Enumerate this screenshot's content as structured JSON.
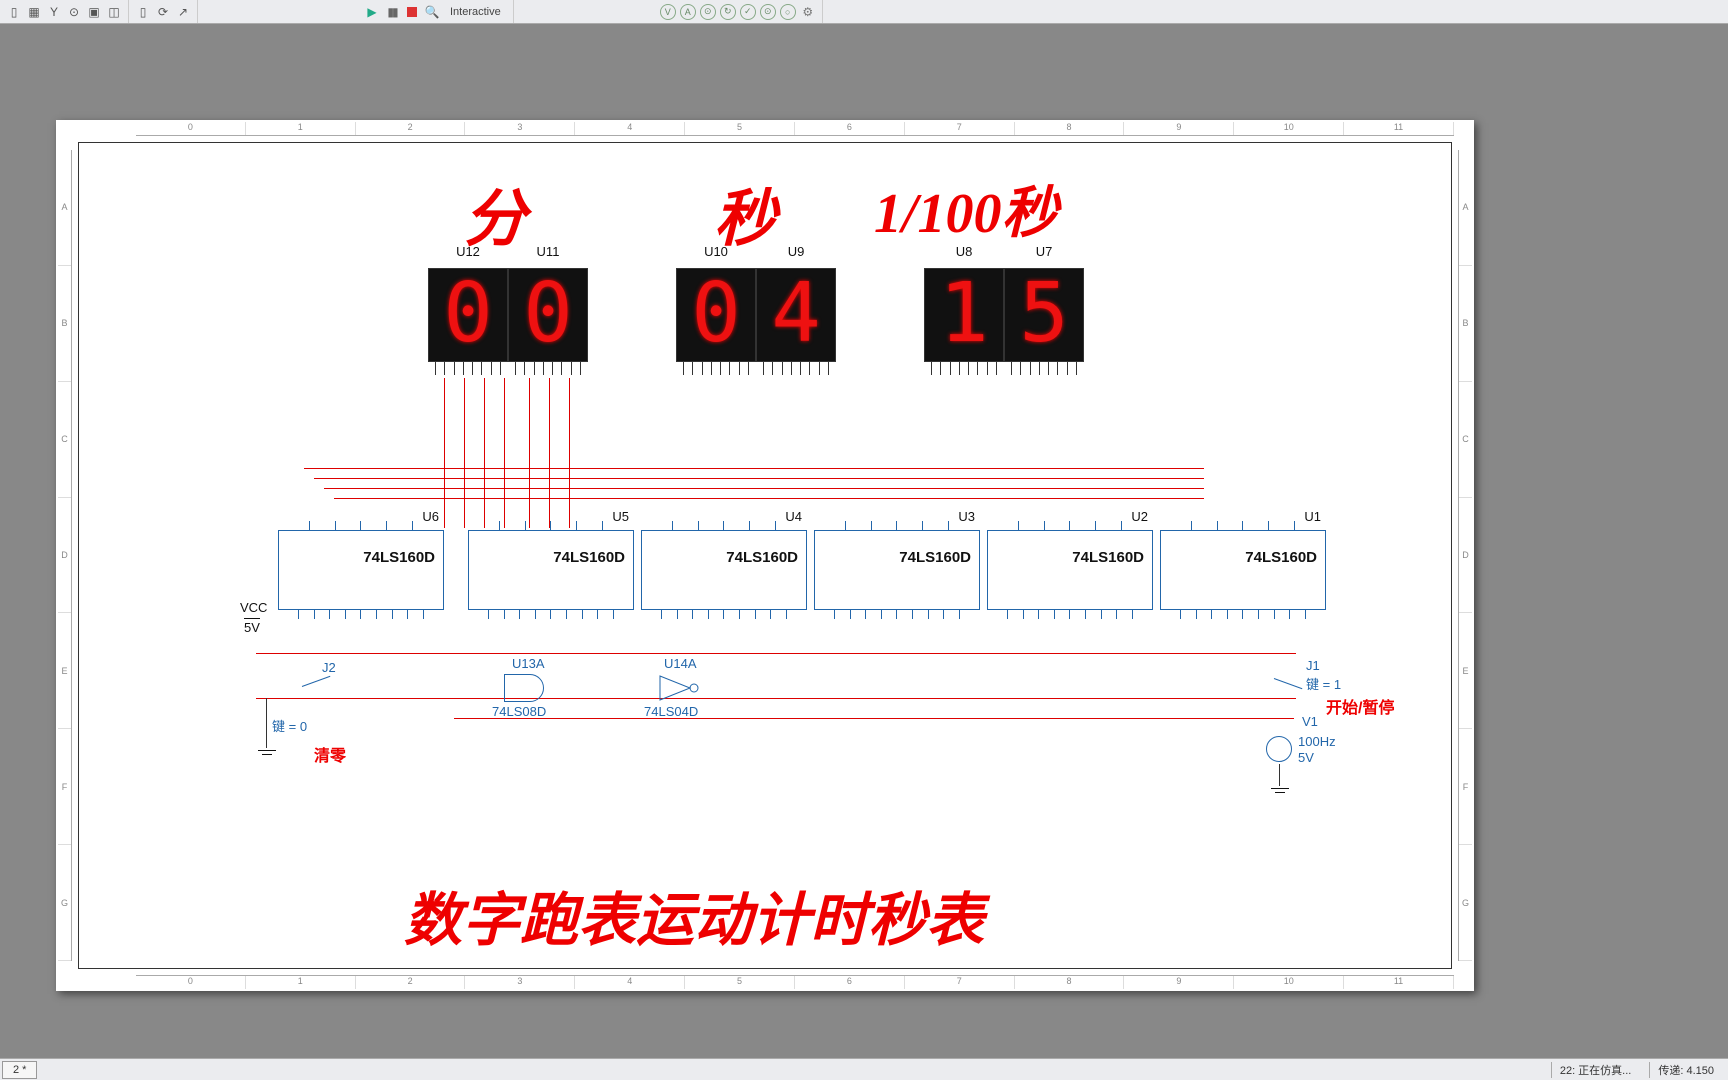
{
  "toolbar": {
    "interactive": "Interactive"
  },
  "headers": {
    "min": "分",
    "sec": "秒",
    "cs": "1/100秒"
  },
  "displays": {
    "u12": {
      "ref": "U12",
      "digit": "0"
    },
    "u11": {
      "ref": "U11",
      "digit": "0"
    },
    "u10": {
      "ref": "U10",
      "digit": "0"
    },
    "u9": {
      "ref": "U9",
      "digit": "4"
    },
    "u8": {
      "ref": "U8",
      "digit": "1"
    },
    "u7": {
      "ref": "U7",
      "digit": "5"
    }
  },
  "chips": {
    "type": "74LS160D",
    "u6": "U6",
    "u5": "U5",
    "u4": "U4",
    "u3": "U3",
    "u2": "U2",
    "u1": "U1"
  },
  "gates": {
    "u13a": {
      "ref": "U13A",
      "type": "74LS08D"
    },
    "u14a": {
      "ref": "U14A",
      "type": "74LS04D"
    }
  },
  "power": {
    "vcc": "VCC",
    "v5": "5V"
  },
  "j1": {
    "ref": "J1",
    "key": "键 = 1",
    "label": "开始/暂停"
  },
  "j2": {
    "ref": "J2",
    "key": "键 = 0",
    "label": "清零"
  },
  "v1": {
    "ref": "V1",
    "freq": "100Hz",
    "volt": "5V"
  },
  "title": "数字跑表运动计时秒表",
  "ruler_h": [
    "0",
    "1",
    "2",
    "3",
    "4",
    "5",
    "6",
    "7",
    "8",
    "9",
    "10",
    "11"
  ],
  "ruler_v": [
    "A",
    "B",
    "C",
    "D",
    "E",
    "F",
    "G"
  ],
  "status": {
    "tab": "2 *",
    "sim": "22: 正在仿真...",
    "tran": "传递: 4.150"
  }
}
